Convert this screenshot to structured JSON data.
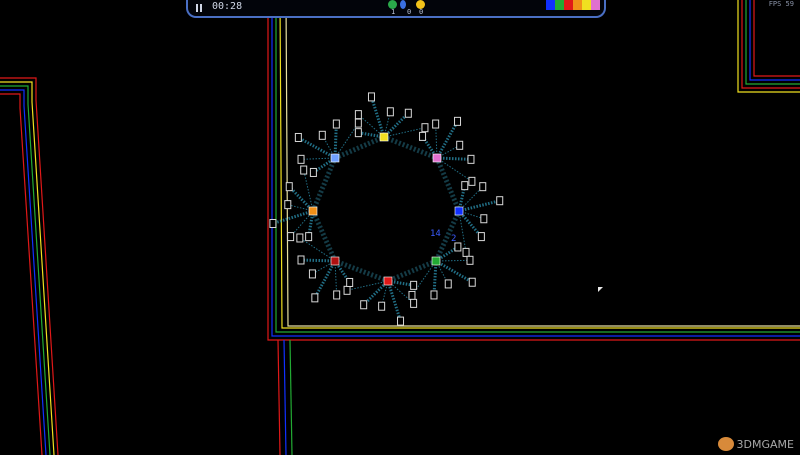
{
  "hud": {
    "timer": "00:28",
    "resources": [
      {
        "name": "green-resource",
        "color": "#2aa84a",
        "count": "1"
      },
      {
        "name": "blue-resource",
        "color": "#3a6fe0",
        "count": "0"
      },
      {
        "name": "yellow-resource",
        "color": "#f2c21a",
        "count": "0"
      }
    ],
    "player_colors": [
      "#1030ff",
      "#22aa33",
      "#e01818",
      "#f09018",
      "#f0e020",
      "#e070d0"
    ]
  },
  "fps_label": "FPS 59",
  "watermark": "3DMGAME",
  "ring_nodes": [
    {
      "id": "yellow",
      "color": "#f0e020",
      "label": ""
    },
    {
      "id": "pink",
      "color": "#e070d0",
      "label": ""
    },
    {
      "id": "blue",
      "color": "#1030ff",
      "label": ""
    },
    {
      "id": "green",
      "color": "#22aa33",
      "label": ""
    },
    {
      "id": "red",
      "color": "#e01818",
      "label": ""
    },
    {
      "id": "darkred",
      "color": "#b01010",
      "label": ""
    },
    {
      "id": "orange",
      "color": "#f09018",
      "label": ""
    },
    {
      "id": "lightblue",
      "color": "#6fa0ff",
      "label": ""
    }
  ],
  "unit_counts": {
    "blue_a": "14",
    "blue_b": "2"
  }
}
